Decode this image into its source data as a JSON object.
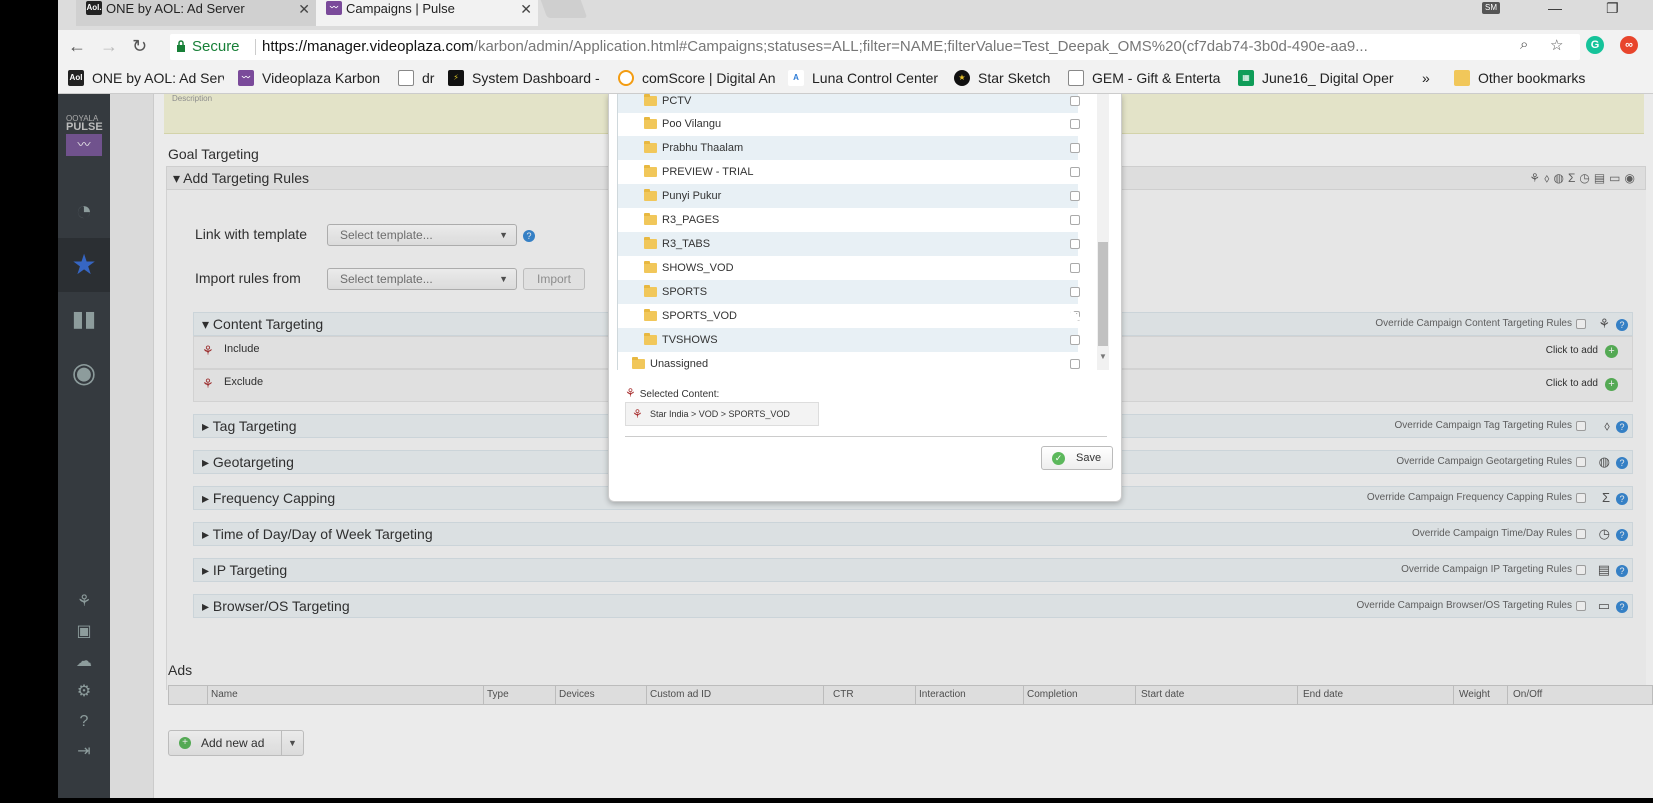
{
  "browser": {
    "tabs": [
      {
        "label": "ONE by AOL: Ad Server",
        "icon": "aol-icon"
      },
      {
        "label": "Campaigns | Pulse",
        "icon": "pulse-icon"
      }
    ],
    "user_badge": "SM",
    "address": {
      "secure_label": "Secure",
      "url_host": "https://manager.videoplaza.com",
      "url_rest": "/karbon/admin/Application.html#Campaigns;statuses=ALL;filter=NAME;filterValue=Test_Deepak_OMS%20(cf7dab74-3b0d-490e-aa9..."
    },
    "bookmarks": [
      {
        "label": "ONE by AOL: Ad Serv",
        "icon": "aol-icon"
      },
      {
        "label": "Videoplaza Karbon",
        "icon": "pulse-icon"
      },
      {
        "label": "dr",
        "icon": "page-icon"
      },
      {
        "label": "System Dashboard -",
        "icon": "dashboard-icon"
      },
      {
        "label": "comScore | Digital An",
        "icon": "comscore-icon"
      },
      {
        "label": "Luna Control Center",
        "icon": "akamai-icon"
      },
      {
        "label": "Star Sketch",
        "icon": "star-sketch-icon"
      },
      {
        "label": "GEM - Gift & Enterta",
        "icon": "page-icon"
      },
      {
        "label": "June16_ Digital Oper",
        "icon": "sheets-icon"
      }
    ],
    "bookmarks_more": "»",
    "other_bookmarks": "Other bookmarks"
  },
  "sidebar": {
    "logo_top": "OOYALA",
    "logo_main": "PULSE"
  },
  "page": {
    "description_label": "Description",
    "goal_targeting_title": "Goal Targeting",
    "add_rules_caption": "Add Targeting Rules",
    "link_template_label": "Link with template",
    "import_rules_label": "Import rules from",
    "select_template_placeholder": "Select template...",
    "import_button": "Import",
    "content_targeting": "Content Targeting",
    "override_content": "Override Campaign Content Targeting Rules",
    "include_label": "Include",
    "exclude_label": "Exclude",
    "click_to_add": "Click to add",
    "sections": [
      {
        "label": "Tag Targeting",
        "override": "Override Campaign Tag Targeting Rules",
        "icon": "tag-icon"
      },
      {
        "label": "Geotargeting",
        "override": "Override Campaign Geotargeting Rules",
        "icon": "globe-icon"
      },
      {
        "label": "Frequency Capping",
        "override": "Override Campaign Frequency Capping Rules",
        "icon": "sigma-icon"
      },
      {
        "label": "Time of Day/Day of Week Targeting",
        "override": "Override Campaign Time/Day Rules",
        "icon": "clock-icon"
      },
      {
        "label": "IP Targeting",
        "override": "Override Campaign IP Targeting Rules",
        "icon": "server-icon"
      },
      {
        "label": "Browser/OS Targeting",
        "override": "Override Campaign Browser/OS Targeting Rules",
        "icon": "laptop-icon"
      }
    ],
    "ads_title": "Ads",
    "ads_columns": [
      "Name",
      "Type",
      "Devices",
      "Custom ad ID",
      "CTR",
      "Interaction",
      "Completion",
      "Start date",
      "End date",
      "Weight",
      "On/Off"
    ],
    "add_new_ad": "Add new ad"
  },
  "modal": {
    "tree_items": [
      {
        "label": "PCTV",
        "checked": false
      },
      {
        "label": "Poo Vilangu",
        "checked": false
      },
      {
        "label": "Prabhu Thaalam",
        "checked": false
      },
      {
        "label": "PREVIEW - TRIAL",
        "checked": false
      },
      {
        "label": "Punyi Pukur",
        "checked": false
      },
      {
        "label": "R3_PAGES",
        "checked": false
      },
      {
        "label": "R3_TABS",
        "checked": false
      },
      {
        "label": "SHOWS_VOD",
        "checked": false
      },
      {
        "label": "SPORTS",
        "checked": false
      },
      {
        "label": "SPORTS_VOD",
        "checked": true
      },
      {
        "label": "TVSHOWS",
        "checked": false
      },
      {
        "label": "Unassigned",
        "checked": false,
        "top_level": true
      }
    ],
    "selected_label": "Selected Content:",
    "selected_chip": "Star India > VOD > SPORTS_VOD",
    "save_button": "Save"
  }
}
